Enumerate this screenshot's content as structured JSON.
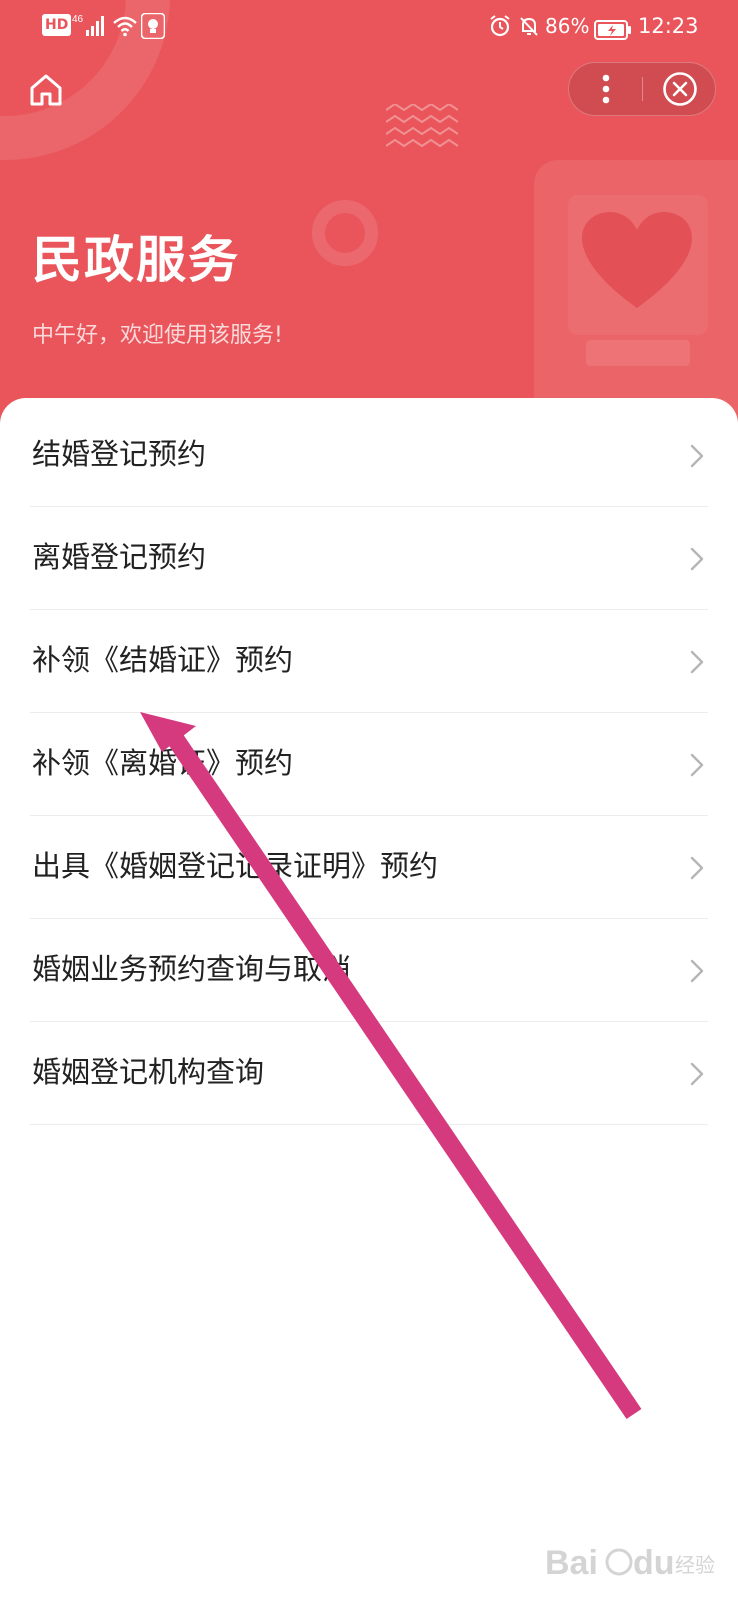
{
  "status_bar": {
    "hd_badge": "HD",
    "network": "46",
    "battery_percent": "86%",
    "time": "12:23"
  },
  "nav": {
    "home_icon": "home-icon",
    "more_icon": "more-vertical-icon",
    "close_icon": "close-circle-icon"
  },
  "header": {
    "title": "民政服务",
    "subtitle": "中午好，欢迎使用该服务!"
  },
  "services": [
    {
      "label": "结婚登记预约"
    },
    {
      "label": "离婚登记预约"
    },
    {
      "label": "补领《结婚证》预约"
    },
    {
      "label": "补领《离婚证》预约"
    },
    {
      "label": "出具《婚姻登记记录证明》预约"
    },
    {
      "label": "婚姻业务预约查询与取消"
    },
    {
      "label": "婚姻登记机构查询"
    }
  ],
  "colors": {
    "header_bg": "#e9555a",
    "arrow": "#d63a7e",
    "text": "#222222",
    "chevron": "#b5b5b5"
  }
}
